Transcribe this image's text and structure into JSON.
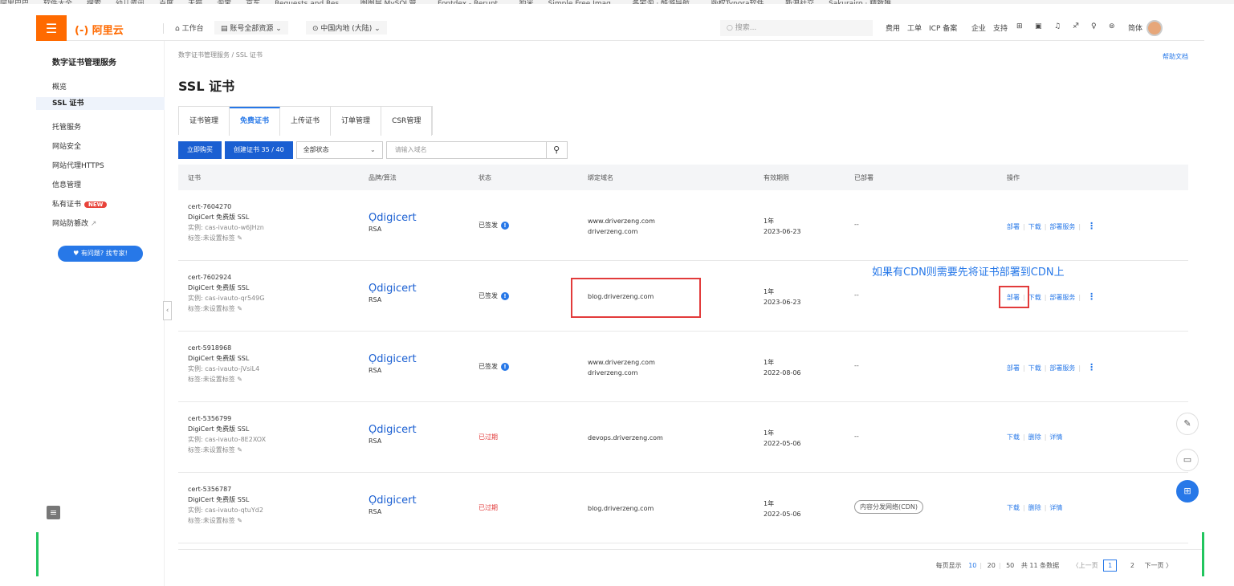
{
  "bookmarks": [
    "阿里巴巴",
    "软件大全",
    "搜索",
    "幼儿资讯",
    "百度",
    "天猫",
    "淘宝",
    "京东",
    "Requests and Res...",
    "图图层 MySQL管...",
    "Fontdex - Rerunt...",
    "豹米",
    "Simple Free Imag...",
    "各宅淘 · 酷游导航...",
    "版权Typora软件...",
    "新浪社交",
    "Sakurairo · 精致唯..."
  ],
  "topbar": {
    "logo": "(-) 阿里云",
    "workbench": "⌂ 工作台",
    "resources": "▤ 账号全部资源 ⌄",
    "region": "⊙ 中国内地 (大陆) ⌄",
    "search_placeholder": "○ 搜索...",
    "right_items": [
      "费用",
      "工单",
      "ICP 备案",
      "企业",
      "支持"
    ],
    "lang": "简体"
  },
  "sidebar": {
    "title": "数字证书管理服务",
    "items": [
      {
        "label": "概览"
      },
      {
        "label": "SSL 证书"
      },
      {
        "label": "托管服务"
      },
      {
        "label": "网站安全"
      },
      {
        "label": "网站代理HTTPS"
      },
      {
        "label": "信息管理"
      },
      {
        "label": "私有证书"
      },
      {
        "label": "网站防篡改"
      }
    ],
    "new_badge": "NEW",
    "ask_button": "♥ 有问题? 找专家!"
  },
  "main": {
    "breadcrumb": "数字证书管理服务 / SSL 证书",
    "help": "帮助文档",
    "title": "SSL 证书",
    "tabs": [
      "证书管理",
      "免费证书",
      "上传证书",
      "订单管理",
      "CSR管理"
    ],
    "toolbar": {
      "buy": "立即购买",
      "create": "创建证书 35 / 40",
      "status_select": "全部状态",
      "domain_placeholder": "请输入域名"
    },
    "columns": [
      "证书",
      "品牌/算法",
      "状态",
      "绑定域名",
      "有效期限",
      "已部署",
      "操作"
    ],
    "rows": [
      {
        "id": "cert-7604270",
        "name": "DigiCert 免费版 SSL",
        "instance": "实例: cas-ivauto-w6JHzn",
        "tag": "标签:未设置标签",
        "brand": "digicert",
        "algo": "RSA",
        "status": "已签发",
        "domains": [
          "www.driverzeng.com",
          "driverzeng.com"
        ],
        "term": "1年",
        "date": "2023-06-23",
        "deployed": "--",
        "ops": [
          "部署",
          "下载",
          "部署服务"
        ]
      },
      {
        "id": "cert-7602924",
        "name": "DigiCert 免费版 SSL",
        "instance": "实例: cas-ivauto-qr549G",
        "tag": "标签:未设置标签",
        "brand": "digicert",
        "algo": "RSA",
        "status": "已签发",
        "domains": [
          "blog.driverzeng.com"
        ],
        "term": "1年",
        "date": "2023-06-23",
        "deployed": "--",
        "ops": [
          "部署",
          "下载",
          "部署服务"
        ]
      },
      {
        "id": "cert-5918968",
        "name": "DigiCert 免费版 SSL",
        "instance": "实例: cas-ivauto-jVsiL4",
        "tag": "标签:未设置标签",
        "brand": "digicert",
        "algo": "RSA",
        "status": "已签发",
        "domains": [
          "www.driverzeng.com",
          "driverzeng.com"
        ],
        "term": "1年",
        "date": "2022-08-06",
        "deployed": "--",
        "ops": [
          "部署",
          "下载",
          "部署服务"
        ]
      },
      {
        "id": "cert-5356799",
        "name": "DigiCert 免费版 SSL",
        "instance": "实例: cas-ivauto-8E2XOX",
        "tag": "标签:未设置标签",
        "brand": "digicert",
        "algo": "RSA",
        "status": "已过期",
        "domains": [
          "devops.driverzeng.com"
        ],
        "term": "1年",
        "date": "2022-05-06",
        "deployed": "--",
        "ops": [
          "下载",
          "删除",
          "详情"
        ]
      },
      {
        "id": "cert-5356787",
        "name": "DigiCert 免费版 SSL",
        "instance": "实例: cas-ivauto-qtuYd2",
        "tag": "标签:未设置标签",
        "brand": "digicert",
        "algo": "RSA",
        "status": "已过期",
        "domains": [
          "blog.driverzeng.com"
        ],
        "term": "1年",
        "date": "2022-05-06",
        "deployed": "内容分发网络(CDN)",
        "ops": [
          "下载",
          "删除",
          "详情"
        ]
      }
    ],
    "annotation": "如果有CDN则需要先将证书部署到CDN上",
    "pager": {
      "label": "每页显示",
      "sizes": [
        "10",
        "20",
        "50"
      ],
      "total": "共 11 条数据",
      "prev": "〈上一页",
      "pages": [
        "1",
        "2"
      ],
      "next": "下一页 〉"
    }
  },
  "colors": {
    "accent": "#2778e8",
    "brand_orange": "#ff6a00",
    "expired": "#e23b3b"
  }
}
